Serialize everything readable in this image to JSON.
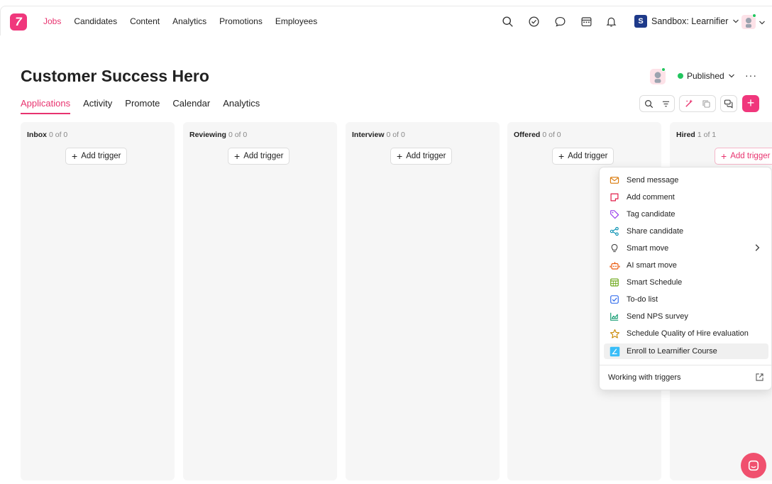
{
  "topbar": {
    "nav": [
      "Jobs",
      "Candidates",
      "Content",
      "Analytics",
      "Promotions",
      "Employees"
    ],
    "active_nav": "Jobs",
    "workspace_badge": "S",
    "workspace_label": "Sandbox: Learnifier"
  },
  "job": {
    "title": "Customer Success Hero",
    "status": "Published"
  },
  "subnav": [
    "Applications",
    "Activity",
    "Promote",
    "Calendar",
    "Analytics"
  ],
  "columns": [
    {
      "name": "Inbox",
      "count": "0 of 0",
      "trigger": "Add trigger"
    },
    {
      "name": "Reviewing",
      "count": "0 of 0",
      "trigger": "Add trigger"
    },
    {
      "name": "Interview",
      "count": "0 of 0",
      "trigger": "Add trigger"
    },
    {
      "name": "Offered",
      "count": "0 of 0",
      "trigger": "Add trigger"
    },
    {
      "name": "Hired",
      "count": "1 of 1",
      "trigger": "Add trigger"
    }
  ],
  "trigger_menu": {
    "items": [
      {
        "label": "Send message",
        "icon": "envelope-icon",
        "color": "#d97706"
      },
      {
        "label": "Add comment",
        "icon": "comment-icon",
        "color": "#e11d48"
      },
      {
        "label": "Tag candidate",
        "icon": "tag-icon",
        "color": "#9333ea"
      },
      {
        "label": "Share candidate",
        "icon": "share-icon",
        "color": "#0891b2"
      },
      {
        "label": "Smart move",
        "icon": "lightbulb-icon",
        "color": "#444444"
      },
      {
        "label": "AI smart move",
        "icon": "robot-icon",
        "color": "#ea580c"
      },
      {
        "label": "Smart Schedule",
        "icon": "calendar-grid-icon",
        "color": "#65a30d"
      },
      {
        "label": "To-do list",
        "icon": "checkbox-icon",
        "color": "#2563eb"
      },
      {
        "label": "Send NPS survey",
        "icon": "chart-area-icon",
        "color": "#059669"
      },
      {
        "label": "Schedule Quality of Hire evaluation",
        "icon": "star-icon",
        "color": "#ca8a04"
      },
      {
        "label": "Enroll to Learnifier Course",
        "icon": "learnifier-icon",
        "color": "#38bdf8"
      }
    ],
    "footer": "Working with triggers"
  }
}
